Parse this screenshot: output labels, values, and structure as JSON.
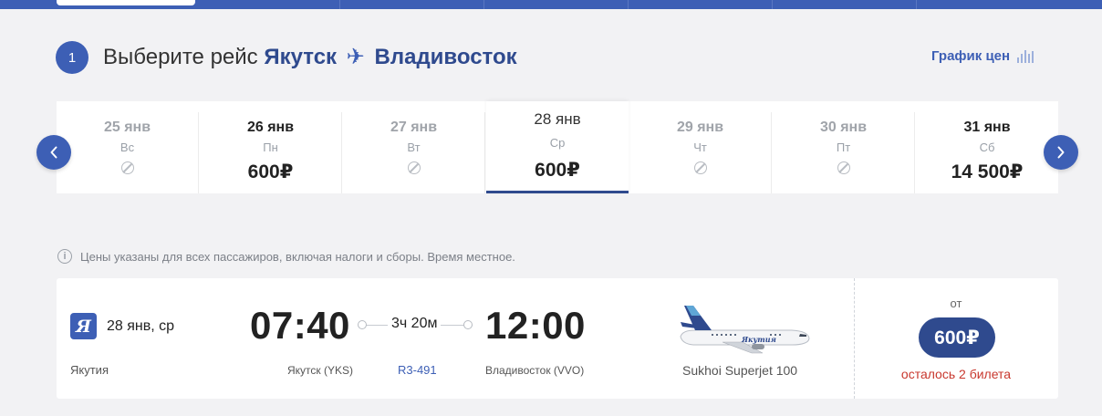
{
  "step": {
    "number": "1",
    "prefix": "Выберите рейс",
    "from": "Якутск",
    "plane_glyph": "✈",
    "to": "Владивосток"
  },
  "price_chart": {
    "label": "График цен",
    "icon": "bars-chart-icon"
  },
  "dates": [
    {
      "date": "25 янв",
      "weekday": "Вс",
      "price": null,
      "available": false
    },
    {
      "date": "26 янв",
      "weekday": "Пн",
      "price": "600₽",
      "available": true
    },
    {
      "date": "27 янв",
      "weekday": "Вт",
      "price": null,
      "available": false
    },
    {
      "date": "28 янв",
      "weekday": "Ср",
      "price": "600₽",
      "available": true,
      "selected": true
    },
    {
      "date": "29 янв",
      "weekday": "Чт",
      "price": null,
      "available": false
    },
    {
      "date": "30 янв",
      "weekday": "Пт",
      "price": null,
      "available": false
    },
    {
      "date": "31 янв",
      "weekday": "Сб",
      "price": "14 500₽",
      "available": true
    }
  ],
  "carousel": {
    "prev_icon": "chevron-left-icon",
    "next_icon": "chevron-right-icon"
  },
  "info_text": "Цены указаны для всех пассажиров, включая налоги и сборы. Время местное.",
  "flight": {
    "airline_logo": "Я",
    "date": "28 янв, ср",
    "airline": "Якутия",
    "departure_time": "07:40",
    "departure_airport": "Якутск (YKS)",
    "duration": "3ч 20м",
    "flight_number": "R3-491",
    "arrival_time": "12:00",
    "arrival_airport": "Владивосток (VVO)",
    "aircraft": "Sukhoi Superjet 100",
    "aircraft_livery_text": "Якутия",
    "from_label": "от",
    "price": "600₽",
    "seats_left": "осталось 2 билета"
  },
  "colors": {
    "brand": "#3d5fb5",
    "brand_dark": "#2f4a8e",
    "warning": "#c8372d"
  }
}
